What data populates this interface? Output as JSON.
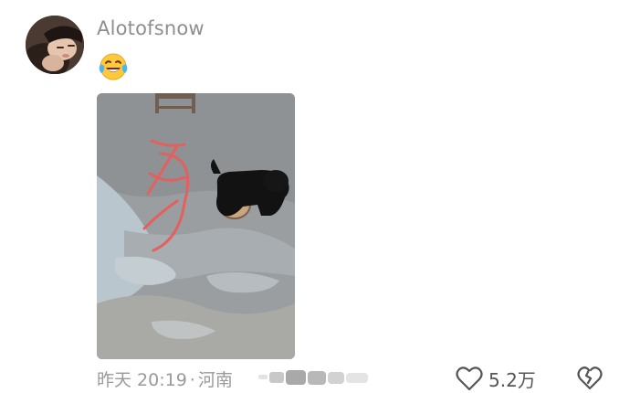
{
  "comment": {
    "username": "Alotofsnow",
    "emoji": "😂",
    "time": "昨天 20:19",
    "separator": "·",
    "location": "河南",
    "like_count": "5.2万"
  },
  "icons": {
    "like": "heart-outline-icon",
    "dislike": "broken-heart-icon"
  },
  "colors": {
    "username": "#8e8e8e",
    "meta_text": "#9a9a9a",
    "annotation_stroke": "#e4605e"
  }
}
